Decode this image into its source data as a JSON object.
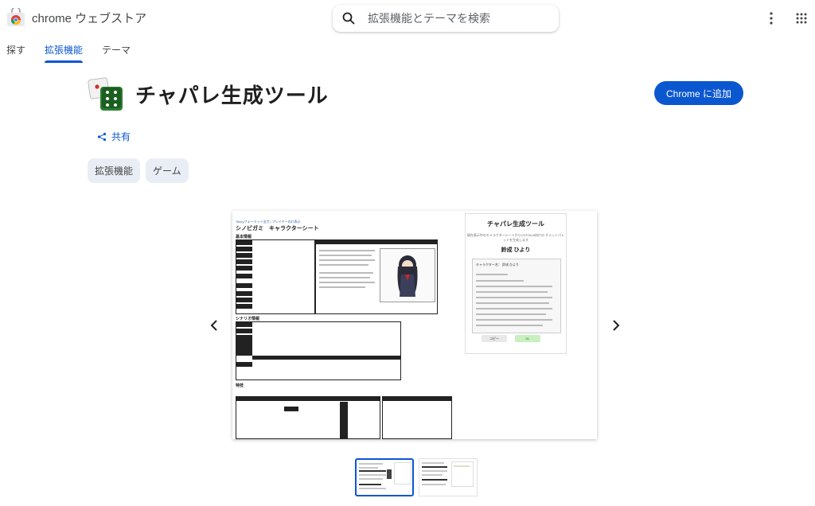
{
  "header": {
    "brand_name": "chrome ウェブストア",
    "search_placeholder": "拡張機能とテーマを検索"
  },
  "tabs": [
    {
      "label": "探す",
      "active": false
    },
    {
      "label": "拡張機能",
      "active": true
    },
    {
      "label": "テーマ",
      "active": false
    }
  ],
  "extension": {
    "title": "チャパレ生成ツール",
    "add_button": "Chrome に追加",
    "share_label": "共有",
    "chips": [
      "拡張機能",
      "ゲーム"
    ]
  },
  "screenshot": {
    "sheet_title": "シノビガミ　キャラクターシート",
    "toolbar_text": "Tekeyフォーマット出力 | プレイヤー向け表示",
    "section_basic": "基本情報",
    "section_scenario": "シナリオ情報",
    "section_skills": "特技",
    "panel_title": "チャパレ生成ツール",
    "panel_subtitle": "現在表示中のキャラクターシートからCCFOLIA向けの チャットパレットを生成します",
    "panel_name": "鈴成 ひより",
    "panel_char_label": "キャラクター名： 鈴成 ひより",
    "copy_button": "コピー",
    "dl_button": "DL"
  },
  "colors": {
    "accent": "#0b57d0",
    "chip_bg": "#e9eef6",
    "icon_bg": "#e7f0e0",
    "dice_green": "#2e7d32"
  },
  "icons": {
    "search": "search-icon",
    "menu": "more-vert-icon",
    "apps": "apps-grid-icon",
    "share": "share-icon",
    "prev": "chevron-left-icon",
    "next": "chevron-right-icon"
  }
}
